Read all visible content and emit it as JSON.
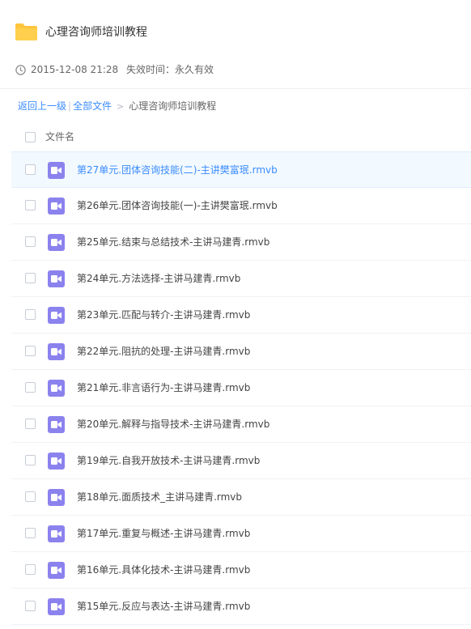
{
  "share": {
    "title": "心理咨询师培训教程",
    "date": "2015-12-08 21:28",
    "expiry": "失效时间：永久有效"
  },
  "breadcrumb": {
    "back": "返回上一级",
    "separator": "|",
    "all_files": "全部文件",
    "arrow": ">",
    "current": "心理咨询师培训教程"
  },
  "list": {
    "column_name": "文件名",
    "files": [
      {
        "name": "第27单元.团体咨询技能(二)-主讲樊富珉.rmvb",
        "selected": true
      },
      {
        "name": "第26单元.团体咨询技能(一)-主讲樊富珉.rmvb",
        "selected": false
      },
      {
        "name": "第25单元.结束与总结技术-主讲马建青.rmvb",
        "selected": false
      },
      {
        "name": "第24单元.方法选择-主讲马建青.rmvb",
        "selected": false
      },
      {
        "name": "第23单元.匹配与转介-主讲马建青.rmvb",
        "selected": false
      },
      {
        "name": "第22单元.阻抗的处理-主讲马建青.rmvb",
        "selected": false
      },
      {
        "name": "第21单元.非言语行为-主讲马建青.rmvb",
        "selected": false
      },
      {
        "name": "第20单元.解释与指导技术-主讲马建青.rmvb",
        "selected": false
      },
      {
        "name": "第19单元.自我开放技术-主讲马建青.rmvb",
        "selected": false
      },
      {
        "name": "第18单元.面质技术_主讲马建青.rmvb",
        "selected": false
      },
      {
        "name": "第17单元.重复与概述-主讲马建青.rmvb",
        "selected": false
      },
      {
        "name": "第16单元.具体化技术-主讲马建青.rmvb",
        "selected": false
      },
      {
        "name": "第15单元.反应与表达-主讲马建青.rmvb",
        "selected": false
      }
    ]
  },
  "colors": {
    "accent": "#3b8cff",
    "folder": "#ffc53d",
    "video_icon": "#8b82ee",
    "selected_row": "#f2f9ff"
  },
  "icons": {
    "folder": "folder-icon",
    "clock": "clock-icon",
    "video": "video-file-icon"
  }
}
